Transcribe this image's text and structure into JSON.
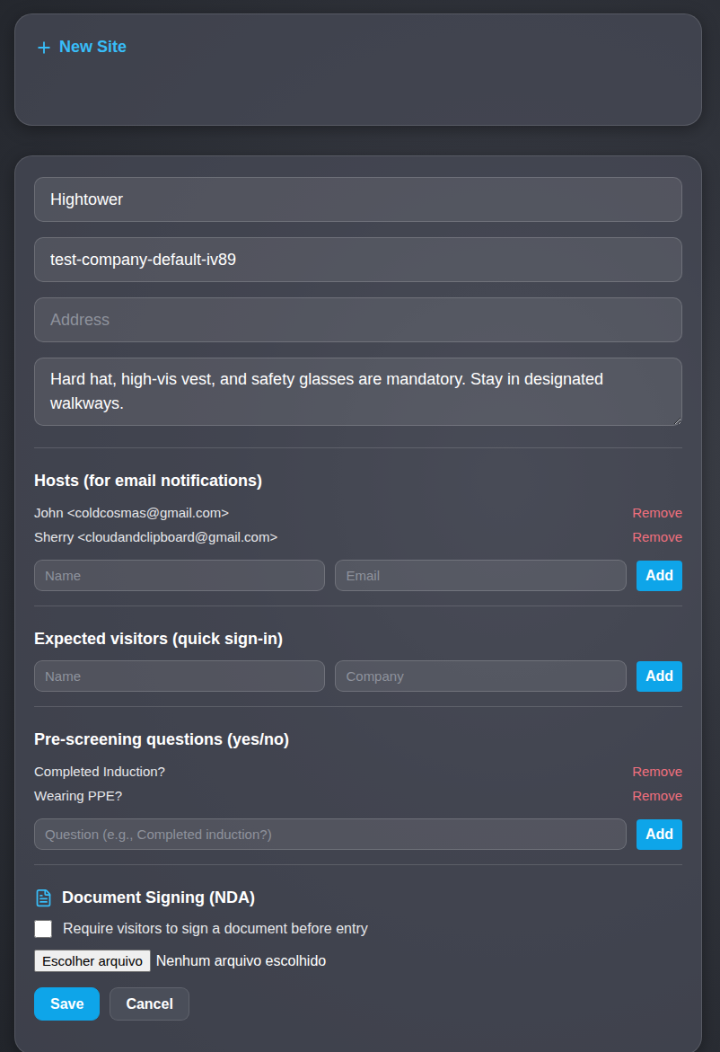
{
  "new_site": {
    "label": "New Site"
  },
  "form": {
    "name": {
      "value": "Hightower"
    },
    "slug": {
      "value": "test-company-default-iv89"
    },
    "address": {
      "placeholder": "Address",
      "value": ""
    },
    "safety_notes": {
      "value": "Hard hat, high-vis vest, and safety glasses are mandatory. Stay in designated walkways."
    }
  },
  "hosts": {
    "title": "Hosts (for email notifications)",
    "items": [
      {
        "text": "John <coldcosmas@gmail.com>",
        "action": "Remove"
      },
      {
        "text": "Sherry <cloudandclipboard@gmail.com>",
        "action": "Remove"
      }
    ],
    "fields": [
      {
        "placeholder": "Name"
      },
      {
        "placeholder": "Email"
      }
    ],
    "add_label": "Add"
  },
  "expected_visitors": {
    "title": "Expected visitors (quick sign-in)",
    "items": [],
    "fields": [
      {
        "placeholder": "Name"
      },
      {
        "placeholder": "Company"
      }
    ],
    "add_label": "Add"
  },
  "questions": {
    "title": "Pre-screening questions (yes/no)",
    "items": [
      {
        "text": "Completed Induction?",
        "action": "Remove"
      },
      {
        "text": "Wearing PPE?",
        "action": "Remove"
      }
    ],
    "fields": [
      {
        "placeholder": "Question (e.g., Completed induction?)"
      }
    ],
    "add_label": "Add"
  },
  "document_signing": {
    "title": "Document Signing (NDA)",
    "checkbox": {
      "label": "Require visitors to sign a document before entry",
      "checked": false
    },
    "file": {
      "button": "Escolher arquivo",
      "status": "Nenhum arquivo escolhido"
    }
  },
  "buttons": [
    {
      "label": "Save",
      "kind": "primary"
    },
    {
      "label": "Cancel",
      "kind": "secondary"
    }
  ]
}
